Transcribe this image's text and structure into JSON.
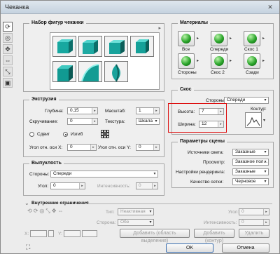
{
  "window": {
    "title": "Чеканка",
    "close_glyph": "✕"
  },
  "shapes_panel": {
    "title": "Набор фигур чеканки",
    "menu_glyph": "▸"
  },
  "extrusion": {
    "title": "Экструзия",
    "depth_label": "Глубина:",
    "depth_value": "0,15",
    "scale_label": "Масштаб:",
    "scale_value": "1",
    "twist_label": "Скручивание:",
    "twist_value": "0",
    "texture_label": "Текстура:",
    "texture_value": "Шкала",
    "shift_label": "Сдвиг",
    "bend_label": "Изгиб",
    "angle_x_label": "Угол отн. оси X:",
    "angle_x_value": "0",
    "angle_y_label": "Угол отн. оси Y:",
    "angle_y_value": "0"
  },
  "bulge": {
    "title": "Выпуклость",
    "sides_label": "Стороны:",
    "sides_value": "Спереди",
    "angle_label": "Угол:",
    "angle_value": "0",
    "intensity_label": "Интенсивность:",
    "intensity_value": "0"
  },
  "inner": {
    "title": "Внутренние ограничения",
    "type_label": "Тип:",
    "type_value": "Неактивная",
    "sides_label": "Сторона:",
    "sides_value": "Обе",
    "angle_label": "Угол:",
    "angle_value": "0",
    "intensity_label": "Интенсивность:",
    "intensity_value": "0",
    "x_label": "X:",
    "y_label": "Y:",
    "add_selection": "Добавить (область выделения)",
    "add_contour": "Добавить (контур)",
    "delete": "Удалить"
  },
  "materials": {
    "title": "Материалы",
    "items": [
      "Все",
      "Спереди",
      "Скос 1",
      "Стороны",
      "Скос 2",
      "Сзади"
    ]
  },
  "bevel": {
    "title": "Скос",
    "sides_label": "Стороны:",
    "sides_value": "Спереди",
    "height_label": "Высота:",
    "height_value": "7",
    "width_label": "Ширина:",
    "width_value": "12",
    "contour_label": "Контур:"
  },
  "scene": {
    "title": "Параметры сцены",
    "lights_label": "Источники света:",
    "lights_value": "Заказные",
    "view_label": "Просмотр:",
    "view_value": "Заказное пол...",
    "render_label": "Настройки рендеринга:",
    "render_value": "Заказные",
    "quality_label": "Качество сетки:",
    "quality_value": "Черновое"
  },
  "footer": {
    "ok": "OK",
    "cancel": "Отмена"
  },
  "colors": {
    "highlight": "#d11111",
    "ok_border": "#3b6fb0"
  }
}
